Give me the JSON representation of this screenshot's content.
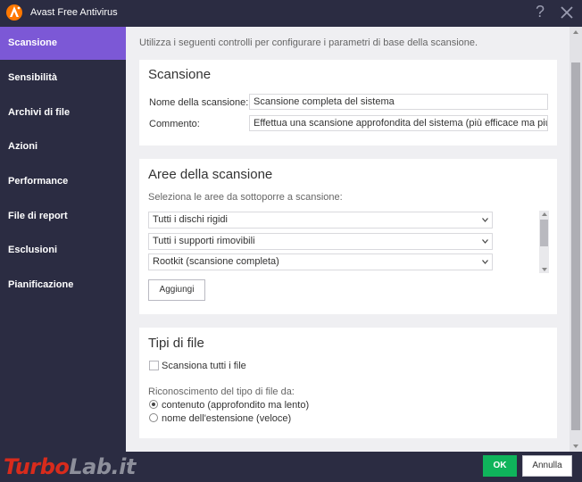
{
  "window": {
    "title": "Avast Free Antivirus",
    "help_label": "?"
  },
  "sidebar": {
    "items": [
      {
        "label": "Scansione"
      },
      {
        "label": "Sensibilità"
      },
      {
        "label": "Archivi di file"
      },
      {
        "label": "Azioni"
      },
      {
        "label": "Performance"
      },
      {
        "label": "File di report"
      },
      {
        "label": "Esclusioni"
      },
      {
        "label": "Pianificazione"
      }
    ]
  },
  "intro": "Utilizza i seguenti controlli per configurare i parametri di base della scansione.",
  "scan_section": {
    "title": "Scansione",
    "name_label": "Nome della scansione:",
    "name_value": "Scansione completa del sistema",
    "comment_label": "Commento:",
    "comment_value": "Effettua una scansione approfondita del sistema (più efficace ma più le"
  },
  "areas_section": {
    "title": "Aree della scansione",
    "hint": "Seleziona le aree da sottoporre a scansione:",
    "areas": [
      {
        "value": "Tutti i dischi rigidi"
      },
      {
        "value": "Tutti i supporti rimovibili"
      },
      {
        "value": "Rootkit (scansione completa)"
      }
    ],
    "add_label": "Aggiungi"
  },
  "types_section": {
    "title": "Tipi di file",
    "scan_all_label": "Scansiona tutti i file",
    "scan_all_checked": false,
    "recognition_label": "Riconoscimento del tipo di file da:",
    "options": [
      {
        "label": "contenuto (approfondito ma lento)",
        "checked": true
      },
      {
        "label": "nome dell'estensione (veloce)",
        "checked": false
      }
    ]
  },
  "footer": {
    "ok_label": "OK",
    "cancel_label": "Annulla"
  },
  "watermark": {
    "part1": "Turbo",
    "part2": "Lab.it"
  },
  "colors": {
    "accent": "#7c58d6",
    "ok_button": "#0fb45b",
    "frame": "#2b2c42",
    "avast_orange": "#ff7800"
  }
}
